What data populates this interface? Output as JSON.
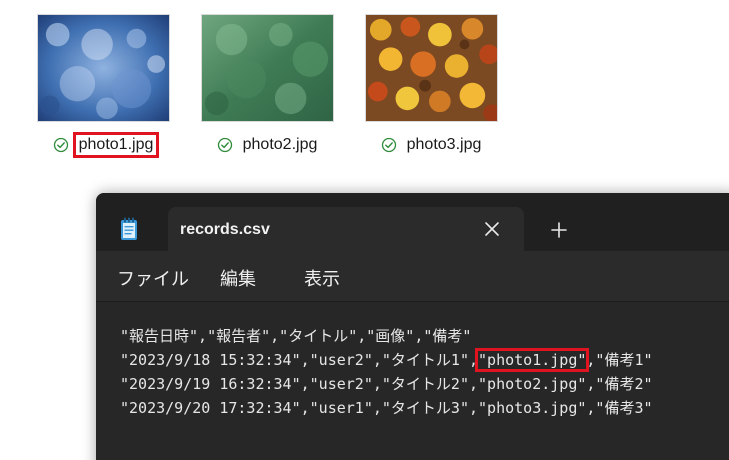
{
  "explorer": {
    "files": [
      {
        "name": "photo1.jpg",
        "status_icon": "synced-check-icon",
        "highlighted": true
      },
      {
        "name": "photo2.jpg",
        "status_icon": "synced-check-icon",
        "highlighted": false
      },
      {
        "name": "photo3.jpg",
        "status_icon": "synced-check-icon",
        "highlighted": false
      }
    ]
  },
  "notepad": {
    "app_icon": "notepad-icon",
    "tab": {
      "title": "records.csv",
      "close_icon": "close-icon"
    },
    "new_tab_icon": "plus-icon",
    "menu": [
      "ファイル",
      "編集",
      "表示"
    ],
    "lines": [
      {
        "text": "\"報告日時\",\"報告者\",\"タイトル\",\"画像\",\"備考\""
      },
      {
        "before": "\"2023/9/18 15:32:34\",\"user2\",\"タイトル1\",",
        "highlight": "\"photo1.jpg\"",
        "after": ",\"備考1\""
      },
      {
        "text": "\"2023/9/19 16:32:34\",\"user2\",\"タイトル2\",\"photo2.jpg\",\"備考2\""
      },
      {
        "text": "\"2023/9/20 17:32:34\",\"user1\",\"タイトル3\",\"photo3.jpg\",\"備考3\""
      }
    ]
  },
  "colors": {
    "highlight": "#e0141e",
    "check": "#2e8b3a",
    "notepad_bg": "#272727",
    "titlebar_bg": "#202020"
  }
}
